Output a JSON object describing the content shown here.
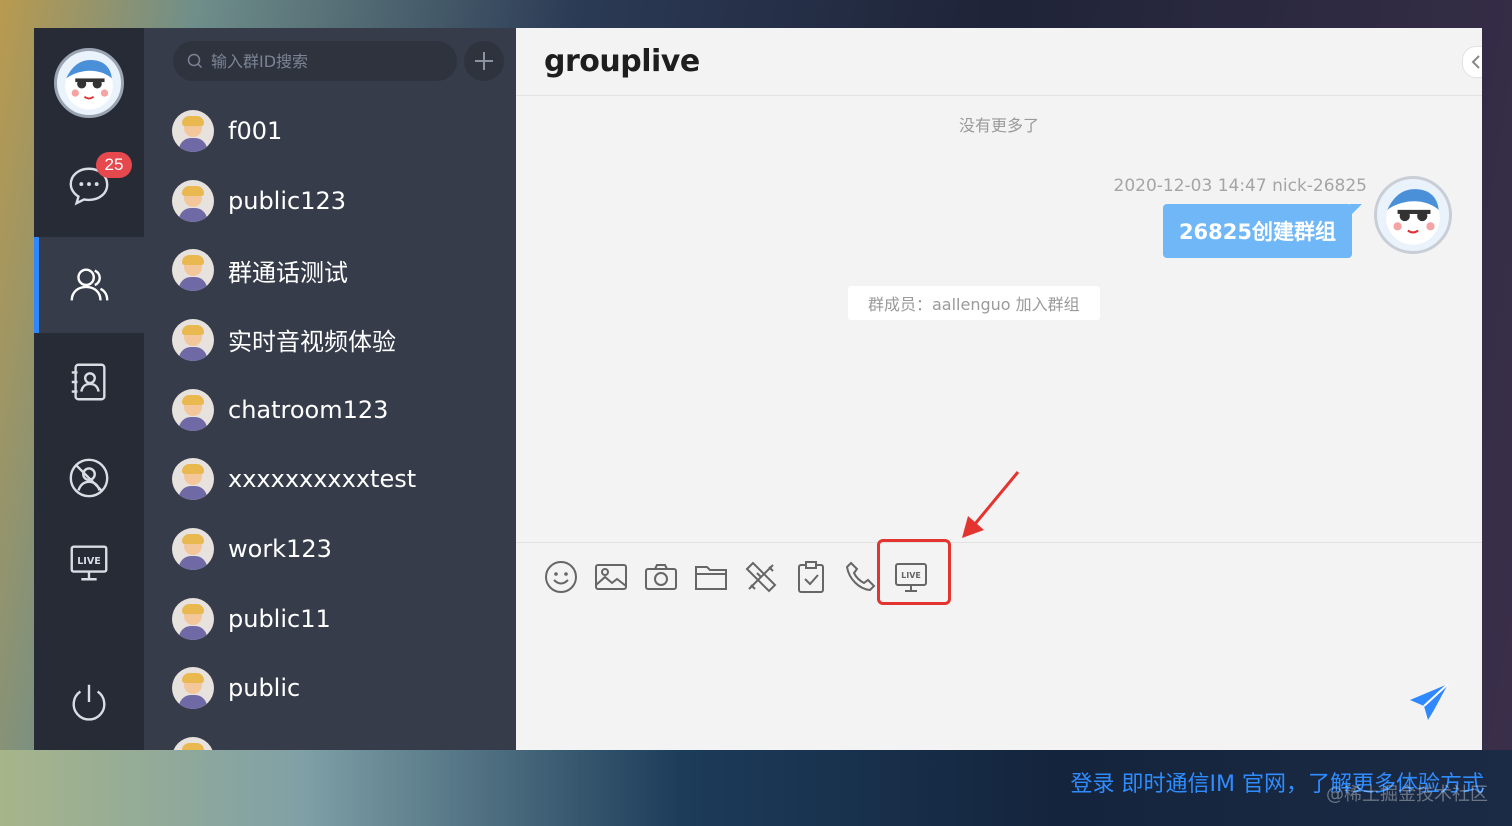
{
  "nav": {
    "badge_count": "25",
    "items": [
      "chat-icon",
      "group-icon",
      "contacts-icon",
      "blocked-icon",
      "live-icon",
      "power-icon"
    ]
  },
  "search": {
    "placeholder": "输入群ID搜索"
  },
  "groups": [
    {
      "name": "f001"
    },
    {
      "name": "public123"
    },
    {
      "name": "群通话测试"
    },
    {
      "name": "实时音视频体验"
    },
    {
      "name": "chatroom123"
    },
    {
      "name": "xxxxxxxxxxtest"
    },
    {
      "name": "work123"
    },
    {
      "name": "public11"
    },
    {
      "name": "public"
    }
  ],
  "chat": {
    "title": "grouplive",
    "no_more": "没有更多了",
    "message_meta": "2020-12-03 14:47 nick-26825",
    "message_text": "26825创建群组",
    "system_note": "群成员：aallenguo 加入群组"
  },
  "toolbar": [
    "emoji-icon",
    "image-icon",
    "camera-icon",
    "folder-icon",
    "custom-icon",
    "survey-icon",
    "call-icon",
    "live-icon"
  ],
  "caption": "登录 即时通信IM 官网，了解更多体验方式",
  "watermark": "@稀土掘金技术社区",
  "colors": {
    "accent": "#2f88ff",
    "bubble": "#6fb7f7",
    "badge": "#e5484d",
    "highlight": "#e3342f"
  }
}
